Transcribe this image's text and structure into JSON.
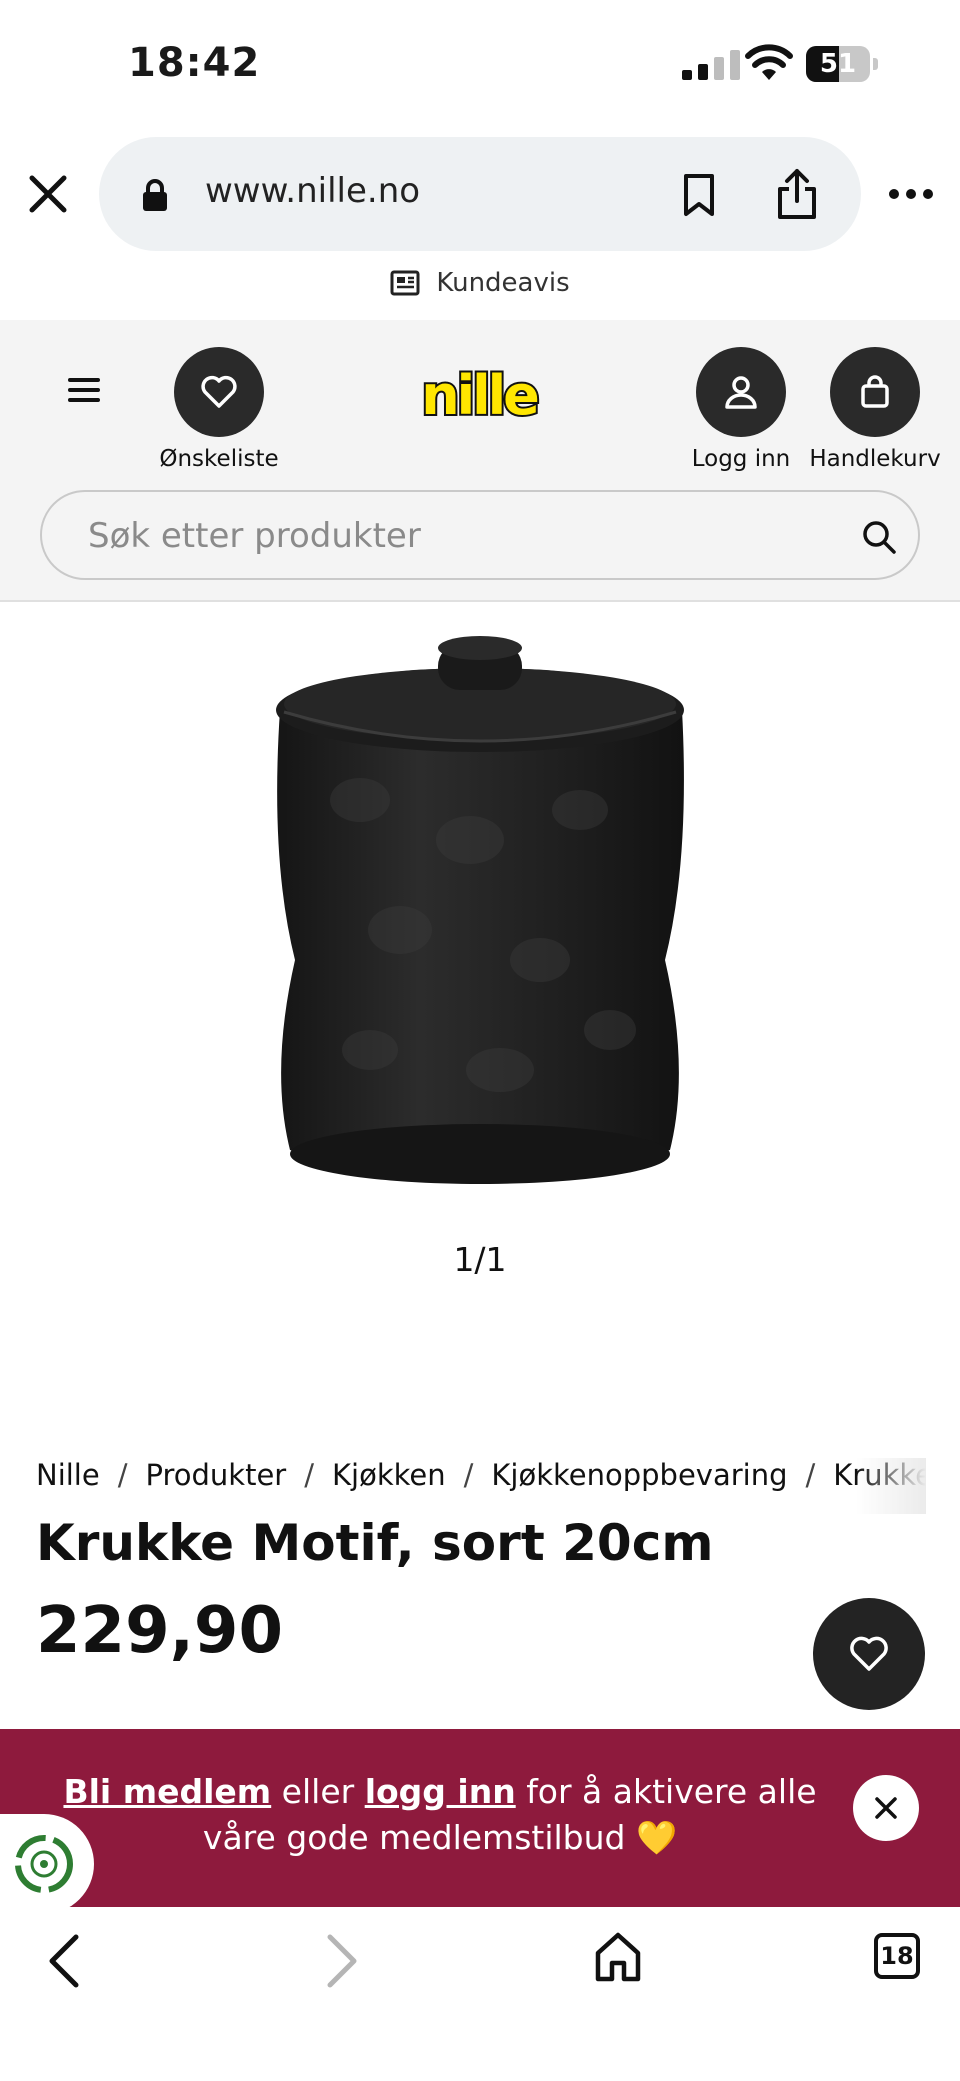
{
  "status_bar": {
    "time": "18:42",
    "battery_level": "51"
  },
  "browser": {
    "url": "www.nille.no",
    "kundeavis_label": "Kundeavis"
  },
  "header": {
    "logo_text": "nille",
    "wishlist_label": "Ønskeliste",
    "login_label": "Logg inn",
    "cart_label": "Handlekurv",
    "search_placeholder": "Søk etter produkter"
  },
  "gallery": {
    "pager": "1/1"
  },
  "breadcrumb": {
    "items": [
      "Nille",
      "Produkter",
      "Kjøkken",
      "Kjøkkenoppbevaring",
      "Krukke"
    ],
    "separator": "/"
  },
  "product": {
    "title": "Krukke Motif, sort 20cm",
    "price": "229,90"
  },
  "banner": {
    "join_link": "Bli medlem",
    "or_text": " eller ",
    "login_link": "logg inn",
    "rest_text": " for å aktivere alle våre gode medlemstilbud 💛",
    "background_color": "#8e1a3d"
  },
  "toolbar": {
    "tab_count": "18"
  },
  "colors": {
    "logo_yellow": "#ffe600",
    "dark_button": "#2a2a2a"
  }
}
